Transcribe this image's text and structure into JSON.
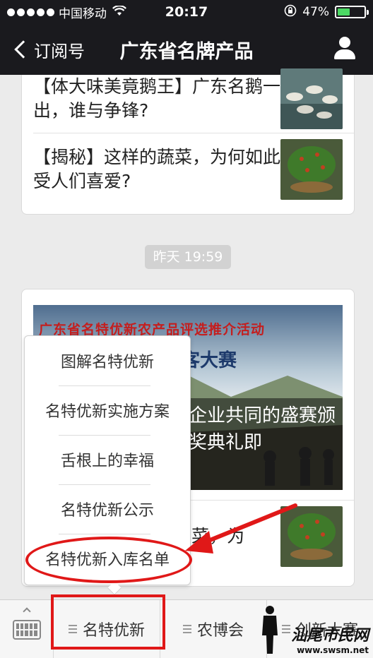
{
  "status_bar": {
    "carrier": "中国移动",
    "time": "20:17",
    "battery": "47%",
    "battery_level": 0.47
  },
  "nav": {
    "back_label": "订阅号",
    "title": "广东省名牌产品"
  },
  "article_list_top": [
    {
      "title": "【体大味美竟鹅王】广东名鹅一出，谁与争锋?"
    },
    {
      "title": "【揭秘】这样的蔬菜，为何如此受人们喜爱?"
    }
  ],
  "timestamp": "昨天 19:59",
  "featured": {
    "banner_title": "广东省名特优新农产品评选推介活动",
    "banner_sub": "客大赛",
    "caption": "企业共同的盛赛颁奖典礼即"
  },
  "second_article_partial": "菜，为",
  "popup_menu": {
    "items": [
      {
        "label": "图解名特优新"
      },
      {
        "label": "名特优新实施方案"
      },
      {
        "label": "舌根上的幸福"
      },
      {
        "label": "名特优新公示"
      },
      {
        "label": "名特优新入库名单"
      }
    ]
  },
  "bottom_menu": {
    "tabs": [
      {
        "label": "名特优新"
      },
      {
        "label": "农博会"
      },
      {
        "label": "创新大赛"
      }
    ]
  },
  "watermark": {
    "logo": "汕尾市民网",
    "url": "www.swsm.net"
  },
  "colors": {
    "annotation_red": "#e01818",
    "header_bg": "#1a1a1e",
    "battery_green": "#4cd964"
  }
}
